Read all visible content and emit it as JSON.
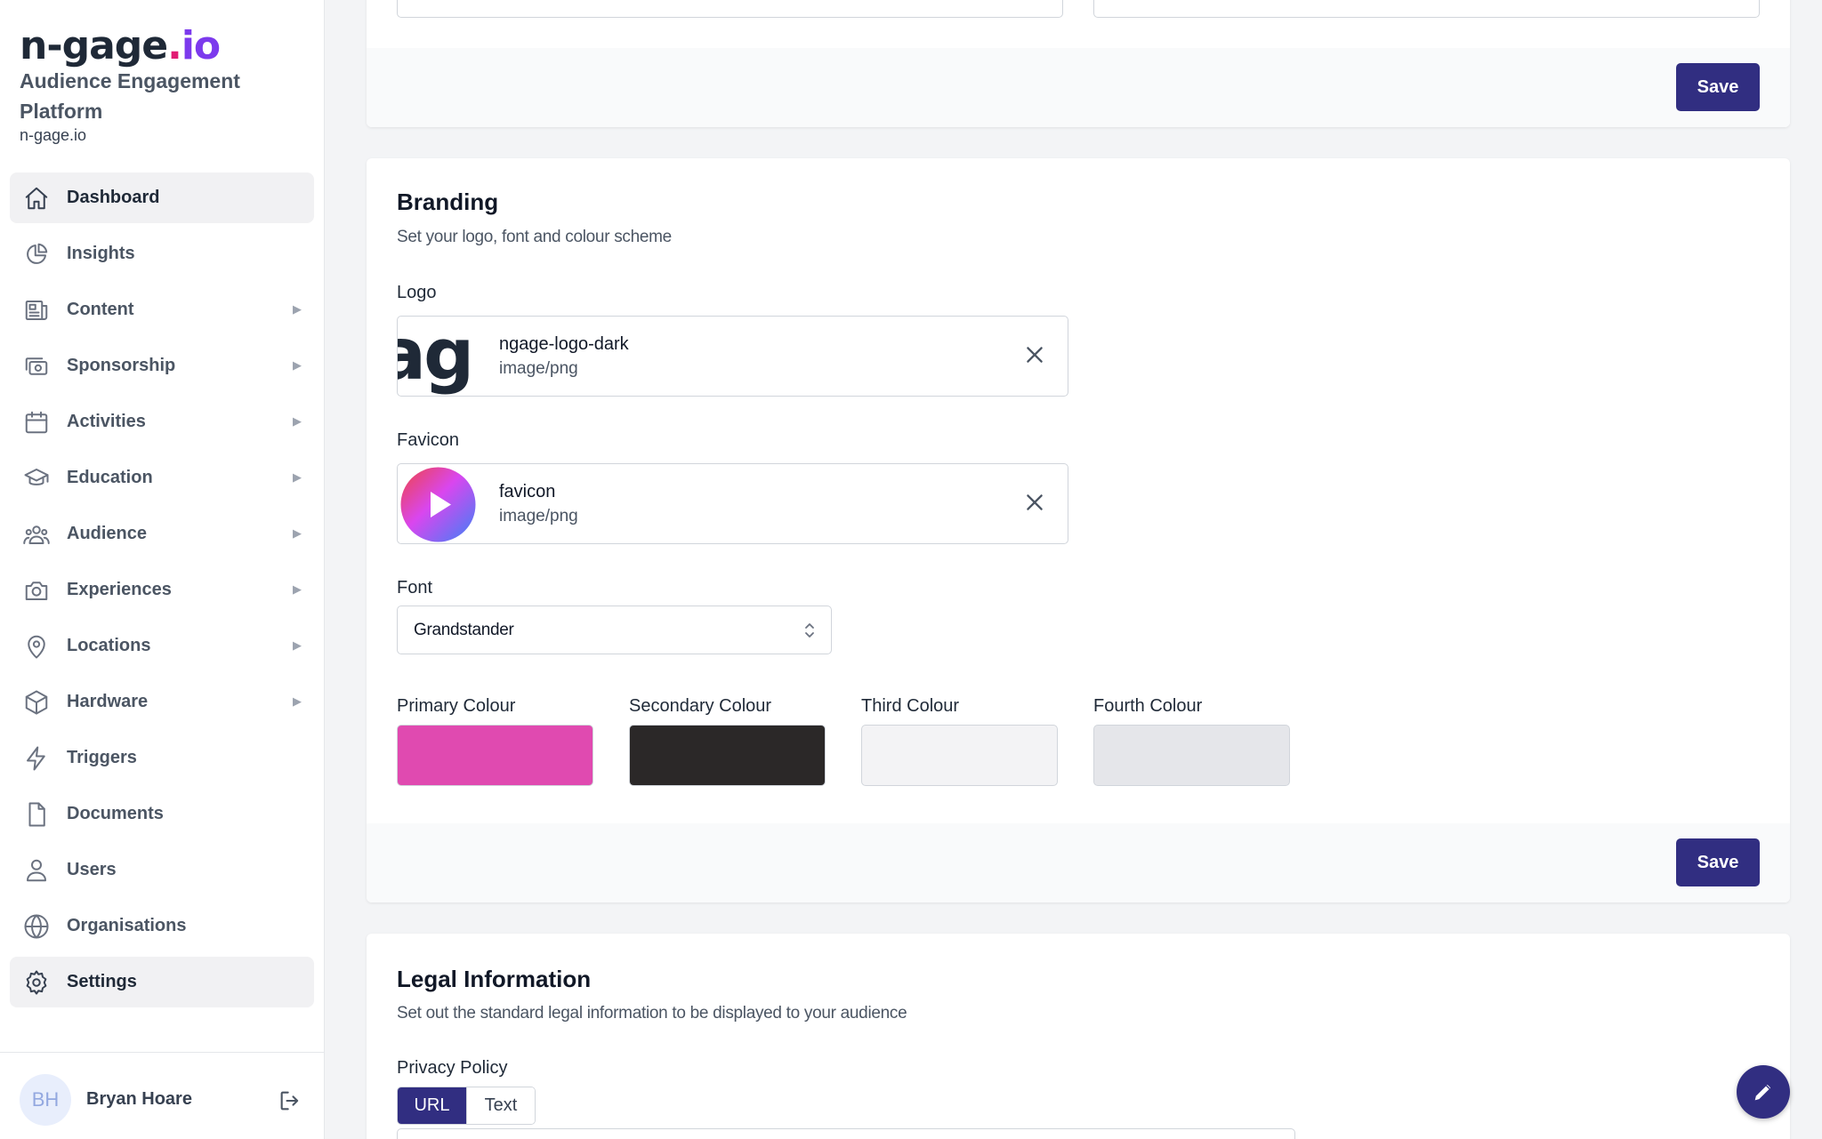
{
  "brand": {
    "logo_main": "n-gage",
    "logo_dot": ".",
    "logo_io": "io",
    "title": "Audience Engagement Platform",
    "domain": "n-gage.io"
  },
  "sidebar": {
    "items": [
      {
        "label": "Dashboard",
        "icon": "home-icon",
        "active": true,
        "has_submenu": false
      },
      {
        "label": "Insights",
        "icon": "pie-chart-icon",
        "has_submenu": false
      },
      {
        "label": "Content",
        "icon": "newspaper-icon",
        "has_submenu": true
      },
      {
        "label": "Sponsorship",
        "icon": "cash-icon",
        "has_submenu": true
      },
      {
        "label": "Activities",
        "icon": "calendar-icon",
        "has_submenu": true
      },
      {
        "label": "Education",
        "icon": "academic-cap-icon",
        "has_submenu": true
      },
      {
        "label": "Audience",
        "icon": "user-group-icon",
        "has_submenu": true
      },
      {
        "label": "Experiences",
        "icon": "camera-icon",
        "has_submenu": true
      },
      {
        "label": "Locations",
        "icon": "location-pin-icon",
        "has_submenu": true
      },
      {
        "label": "Hardware",
        "icon": "cube-icon",
        "has_submenu": true
      },
      {
        "label": "Triggers",
        "icon": "lightning-icon",
        "has_submenu": false
      },
      {
        "label": "Documents",
        "icon": "document-icon",
        "has_submenu": false
      },
      {
        "label": "Users",
        "icon": "user-icon",
        "has_submenu": false
      },
      {
        "label": "Organisations",
        "icon": "globe-icon",
        "has_submenu": false
      },
      {
        "label": "Settings",
        "icon": "gear-icon",
        "active": true,
        "has_submenu": false
      }
    ],
    "caret": "▶"
  },
  "user": {
    "initials": "BH",
    "name": "Bryan Hoare"
  },
  "top_card": {
    "save_label": "Save"
  },
  "branding": {
    "title": "Branding",
    "subtitle": "Set your logo, font and colour scheme",
    "logo_label": "Logo",
    "logo_file": {
      "name": "ngage-logo-dark",
      "type": "image/png",
      "thumb_text": "ag"
    },
    "favicon_label": "Favicon",
    "favicon_file": {
      "name": "favicon",
      "type": "image/png"
    },
    "font_label": "Font",
    "font_value": "Grandstander",
    "colours": [
      {
        "label": "Primary Colour",
        "hex": "#e04ab0"
      },
      {
        "label": "Secondary Colour",
        "hex": "#2b2828"
      },
      {
        "label": "Third Colour",
        "hex": "#f3f3f5"
      },
      {
        "label": "Fourth Colour",
        "hex": "#e5e6ea"
      }
    ],
    "save_label": "Save"
  },
  "legal": {
    "title": "Legal Information",
    "subtitle": "Set out the standard legal information to be displayed to your audience",
    "privacy_label": "Privacy Policy",
    "toggle_options": [
      "URL",
      "Text"
    ],
    "toggle_selected": "URL"
  },
  "colors": {
    "accent": "#312e81"
  }
}
